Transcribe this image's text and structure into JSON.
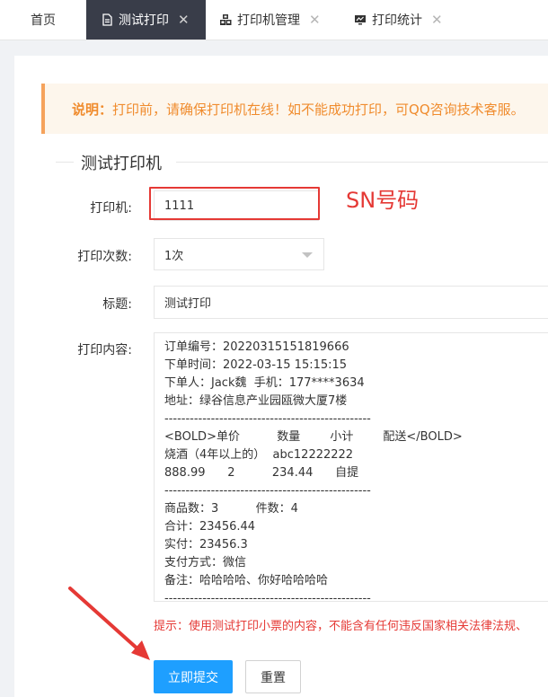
{
  "tabs": [
    {
      "label": "首页",
      "icon": "",
      "closable": false,
      "active": false
    },
    {
      "label": "测试打印",
      "icon": "document-icon",
      "closable": true,
      "active": true
    },
    {
      "label": "打印机管理",
      "icon": "cubes-icon",
      "closable": true,
      "active": false
    },
    {
      "label": "打印统计",
      "icon": "monitor-icon",
      "closable": true,
      "active": false
    }
  ],
  "close_glyph": "✕",
  "notice": {
    "label": "说明：",
    "message": "打印前，请确保打印机在线！如不能成功打印，可QQ咨询技术客服。"
  },
  "section_title": "测试打印机",
  "form": {
    "printer_label": "打印机:",
    "printer_value": "1111",
    "times_label": "打印次数:",
    "times_value": "1次",
    "title_label": "标题:",
    "title_value": "测试打印",
    "content_label": "打印内容:",
    "content_lines": [
      "订单编号：20220315151819666",
      "下单时间：2022-03-15 15:15:15",
      "下单人：Jack魏  手机：177****3634",
      "地址：绿谷信息产业园瓯微大厦7楼",
      "-------------------------------------------------",
      "<BOLD>单价          数量        小计        配送</BOLD>",
      "烧酒（4年以上的）  abc12222222",
      "888.99      2          234.44      自提",
      "-------------------------------------------------",
      "商品数：3          件数：4",
      "合计：23456.44",
      "实付：23456.3",
      "支付方式：微信",
      "备注：哈哈哈哈、你好哈哈哈哈",
      "-------------------------------------------------"
    ],
    "hint": "提示：使用测试打印小票的内容，不能含有任何违反国家相关法律法规、"
  },
  "annotation": {
    "sn_note": "SN号码",
    "color": "#e53935"
  },
  "buttons": {
    "submit": "立即提交",
    "reset": "重置"
  },
  "colors": {
    "accent": "#1e9fff",
    "active_tab": "#393d49",
    "notice_text": "#f08c2e"
  }
}
